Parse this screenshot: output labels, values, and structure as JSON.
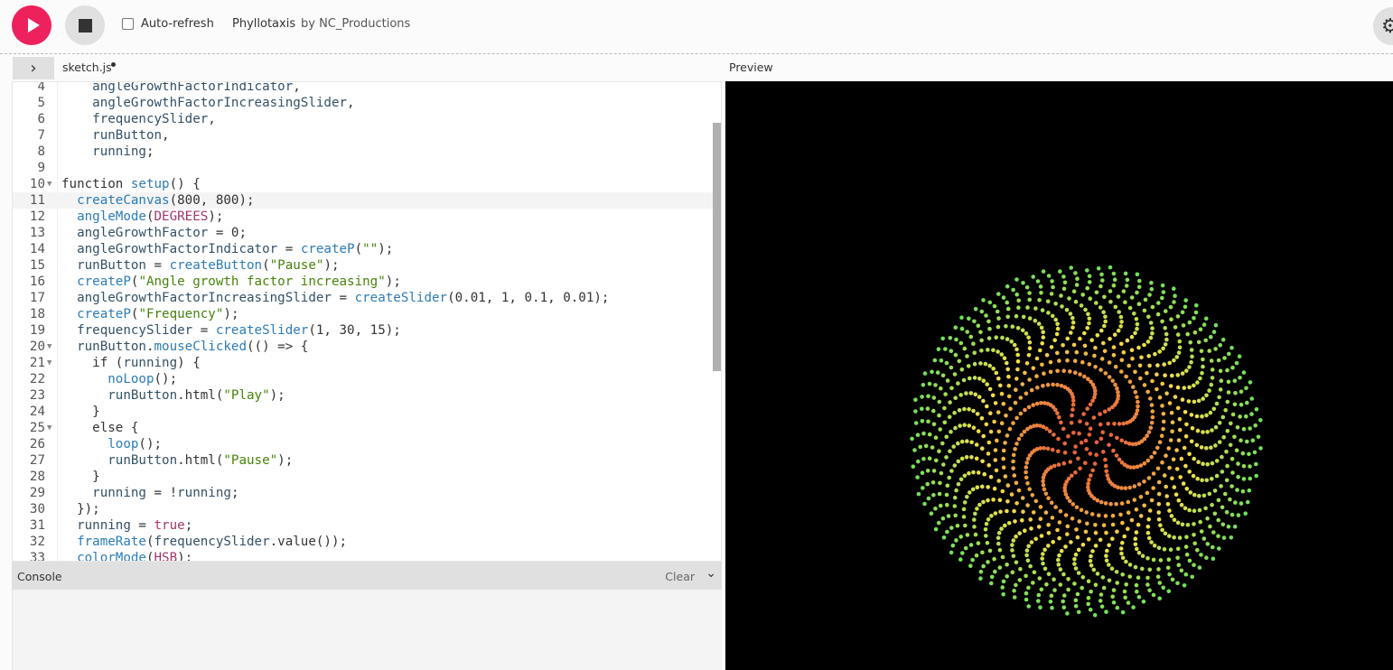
{
  "toolbar": {
    "play_icon": "play-icon",
    "stop_icon": "stop-icon",
    "auto_refresh_label": "Auto-refresh",
    "auto_refresh_checked": false,
    "sketch_name": "Phyllotaxis",
    "author": "by NC_Productions",
    "settings_icon": "gear-icon"
  },
  "editor": {
    "file_tab": "sketch.js",
    "preview_label": "Preview",
    "lines": [
      {
        "n": "4",
        "fold": false,
        "html": "    <span class='v'>angleGrowthFactorIndicator</span>,"
      },
      {
        "n": "5",
        "fold": false,
        "html": "    <span class='v'>angleGrowthFactorIncreasingSlider</span>,"
      },
      {
        "n": "6",
        "fold": false,
        "html": "    <span class='v'>frequencySlider</span>,"
      },
      {
        "n": "7",
        "fold": false,
        "html": "    <span class='v'>runButton</span>,"
      },
      {
        "n": "8",
        "fold": false,
        "html": "    <span class='v'>running</span>;"
      },
      {
        "n": "9",
        "fold": false,
        "html": ""
      },
      {
        "n": "10",
        "fold": true,
        "html": "function <span class='f'>setup</span>() {"
      },
      {
        "n": "11",
        "fold": false,
        "html": "  <span class='f'>createCanvas</span>(800, 800);",
        "active": true
      },
      {
        "n": "12",
        "fold": false,
        "html": "  <span class='f'>angleMode</span>(<span class='c'>DEGREES</span>);"
      },
      {
        "n": "13",
        "fold": false,
        "html": "  <span class='v'>angleGrowthFactor</span> = 0;"
      },
      {
        "n": "14",
        "fold": false,
        "html": "  <span class='v'>angleGrowthFactorIndicator</span> = <span class='f'>createP</span>(<span class='s'>\"\"</span>);"
      },
      {
        "n": "15",
        "fold": false,
        "html": "  <span class='v'>runButton</span> = <span class='f'>createButton</span>(<span class='s'>\"Pause\"</span>);"
      },
      {
        "n": "16",
        "fold": false,
        "html": "  <span class='f'>createP</span>(<span class='s'>\"Angle growth factor increasing\"</span>);"
      },
      {
        "n": "17",
        "fold": false,
        "html": "  <span class='v'>angleGrowthFactorIncreasingSlider</span> = <span class='f'>createSlider</span>(0.01, 1, 0.1, 0.01);"
      },
      {
        "n": "18",
        "fold": false,
        "html": "  <span class='f'>createP</span>(<span class='s'>\"Frequency\"</span>);"
      },
      {
        "n": "19",
        "fold": false,
        "html": "  <span class='v'>frequencySlider</span> = <span class='f'>createSlider</span>(1, 30, 15);"
      },
      {
        "n": "20",
        "fold": true,
        "html": "  <span class='v'>runButton</span>.<span class='f'>mouseClicked</span>(() => {"
      },
      {
        "n": "21",
        "fold": true,
        "html": "    if (<span class='v'>running</span>) {"
      },
      {
        "n": "22",
        "fold": false,
        "html": "      <span class='f'>noLoop</span>();"
      },
      {
        "n": "23",
        "fold": false,
        "html": "      <span class='v'>runButton</span>.html(<span class='s'>\"Play\"</span>);"
      },
      {
        "n": "24",
        "fold": false,
        "html": "    }"
      },
      {
        "n": "25",
        "fold": true,
        "html": "    else {"
      },
      {
        "n": "26",
        "fold": false,
        "html": "      <span class='f'>loop</span>();"
      },
      {
        "n": "27",
        "fold": false,
        "html": "      <span class='v'>runButton</span>.html(<span class='s'>\"Pause\"</span>);"
      },
      {
        "n": "28",
        "fold": false,
        "html": "    }"
      },
      {
        "n": "29",
        "fold": false,
        "html": "    <span class='v'>running</span> = !<span class='v'>running</span>;"
      },
      {
        "n": "30",
        "fold": false,
        "html": "  });"
      },
      {
        "n": "31",
        "fold": false,
        "html": "  <span class='v'>running</span> = <span class='c'>true</span>;"
      },
      {
        "n": "32",
        "fold": false,
        "html": "  <span class='f'>frameRate</span>(<span class='v'>frequencySlider</span>.value());"
      },
      {
        "n": "33",
        "fold": false,
        "html": "  <span class='f'>colorMode</span>(<span class='c'>HSB</span>);"
      }
    ]
  },
  "console": {
    "title": "Console",
    "clear_label": "Clear",
    "chevron_icon": "chevron-down-icon"
  },
  "preview": {
    "background": "#000000",
    "colors": {
      "inner": "#e8603a",
      "middle": "#f5e04a",
      "outer": "#6fe05a"
    }
  }
}
